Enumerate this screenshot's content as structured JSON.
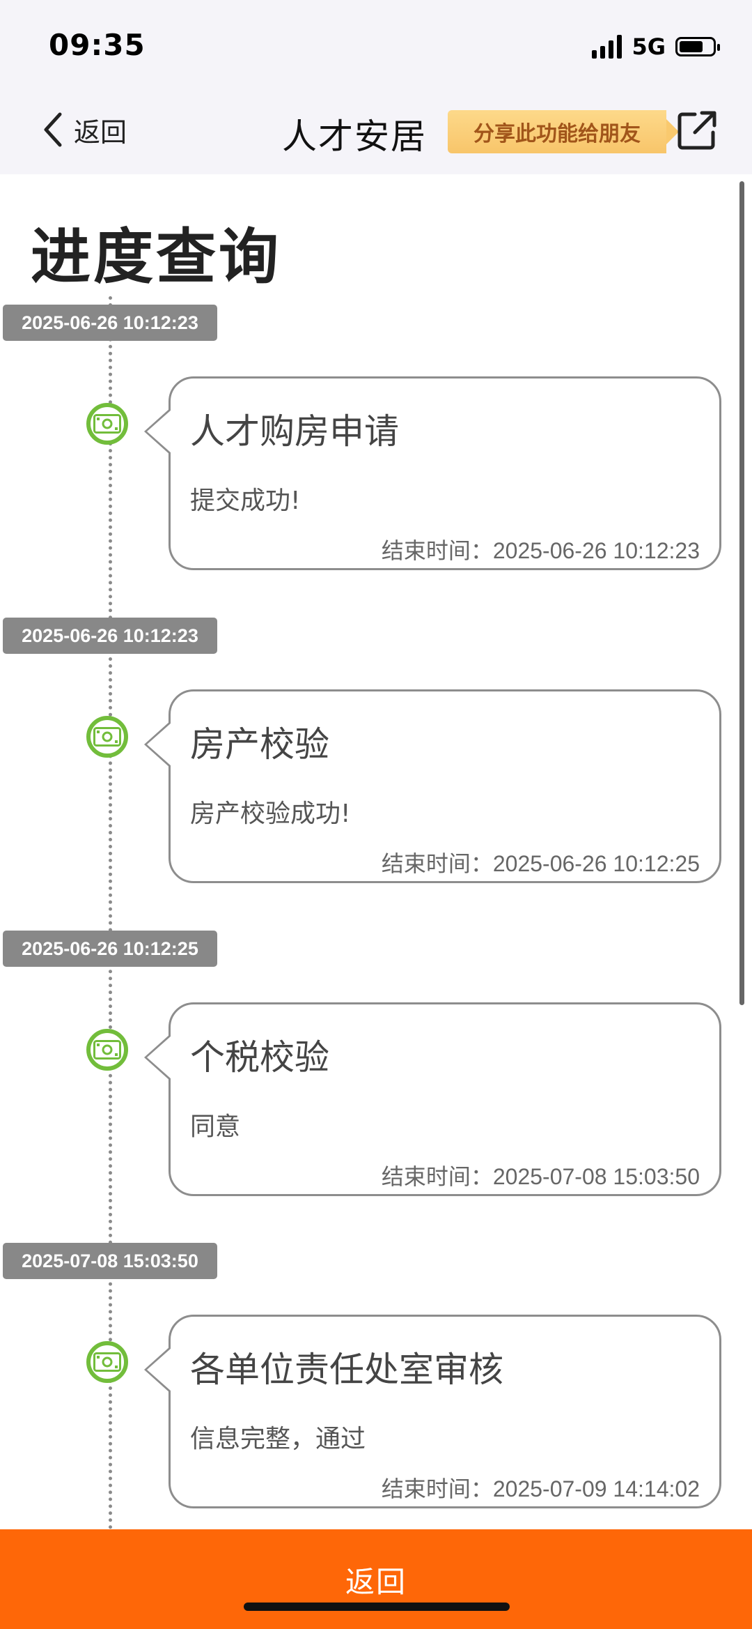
{
  "status_bar": {
    "time": "09:35",
    "network": "5G"
  },
  "nav": {
    "back_label": "返回",
    "title": "人才安居",
    "share_label": "分享此功能给朋友"
  },
  "page_title": "进度查询",
  "steps": [
    {
      "date": "2025-06-26 10:12:23",
      "title": "人才购房申请",
      "status": "提交成功!",
      "end_time": "结束时间：2025-06-26 10:12:23"
    },
    {
      "date": "2025-06-26 10:12:23",
      "title": "房产校验",
      "status": "房产校验成功!",
      "end_time": "结束时间：2025-06-26 10:12:25"
    },
    {
      "date": "2025-06-26 10:12:25",
      "title": "个税校验",
      "status": "同意",
      "end_time": "结束时间：2025-07-08 15:03:50"
    },
    {
      "date": "2025-07-08 15:03:50",
      "title": "各单位责任处室审核",
      "status": "信息完整，通过",
      "end_time": "结束时间：2025-07-09 14:14:02"
    }
  ],
  "bottom_button_label": "返回",
  "colors": {
    "accent": "#fe6708",
    "node_green": "#72bd3b",
    "date_badge": "#888888",
    "share_text": "#a1551a"
  },
  "icons": {
    "node": "money-bill-icon",
    "share": "external-link-icon",
    "back": "chevron-left-icon"
  }
}
